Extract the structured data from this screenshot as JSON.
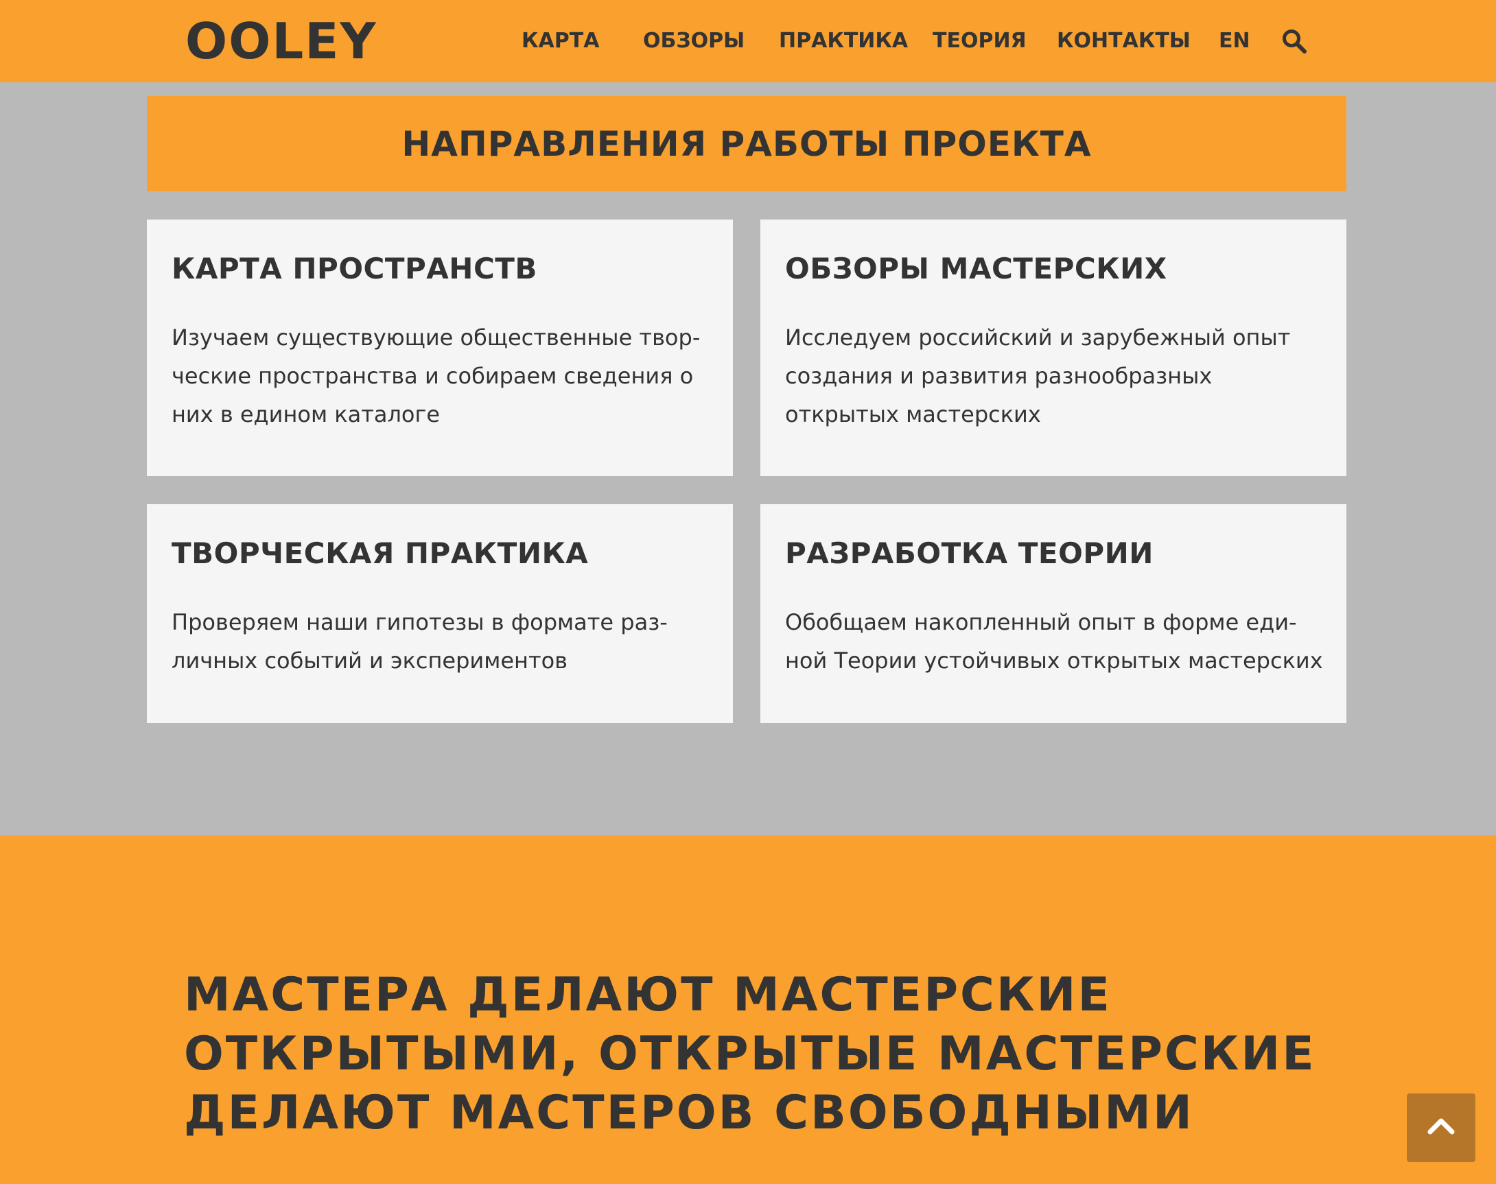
{
  "header": {
    "logo": "OOLEY",
    "nav": {
      "karta": "КАРТА",
      "obzory": "ОБЗОРЫ",
      "praktika": "ПРАКТИКА",
      "teoriya": "ТЕОРИЯ",
      "kontakty": "КОНТАКТЫ",
      "lang": "EN"
    },
    "search_icon": "search-icon"
  },
  "section": {
    "title": "НАПРАВЛЕНИЯ РАБОТЫ ПРОЕКТА",
    "cards": [
      {
        "title": "КАРТА ПРОСТРАНСТВ",
        "text": "Изучаем существующие общественные твор­ческие пространства и собираем сведения о них в едином каталоге"
      },
      {
        "title": "ОБЗОРЫ МАСТЕРСКИХ",
        "text": "Исследуем российский и зарубежный опыт со­здания и развития разнообразных открытых мастерских"
      },
      {
        "title": "ТВОРЧЕСКАЯ ПРАКТИКА",
        "text": "Проверяем наши гипотезы в формате раз­личных событий и экспериментов"
      },
      {
        "title": "РАЗРАБОТКА ТЕОРИИ",
        "text": "Обобщаем накопленный опыт в форме еди­ной Теории устойчивых открытых мастерских"
      }
    ]
  },
  "banner": {
    "text": "МАСТЕРА ДЕЛАЮТ МАСТЕРСКИЕ ОТКРЫТЫМИ, ОТКРЫТЫЕ МАСТЕРСКИЕ ДЕЛАЮТ МАСТЕРОВ СВОБОДНЫМИ"
  },
  "scroll_top_icon": "chevron-up-icon",
  "colors": {
    "accent": "#f9a02e",
    "background": "#b9b9b9",
    "card": "#f5f5f5",
    "text": "#333333",
    "scroll_button": "#b5762a"
  }
}
